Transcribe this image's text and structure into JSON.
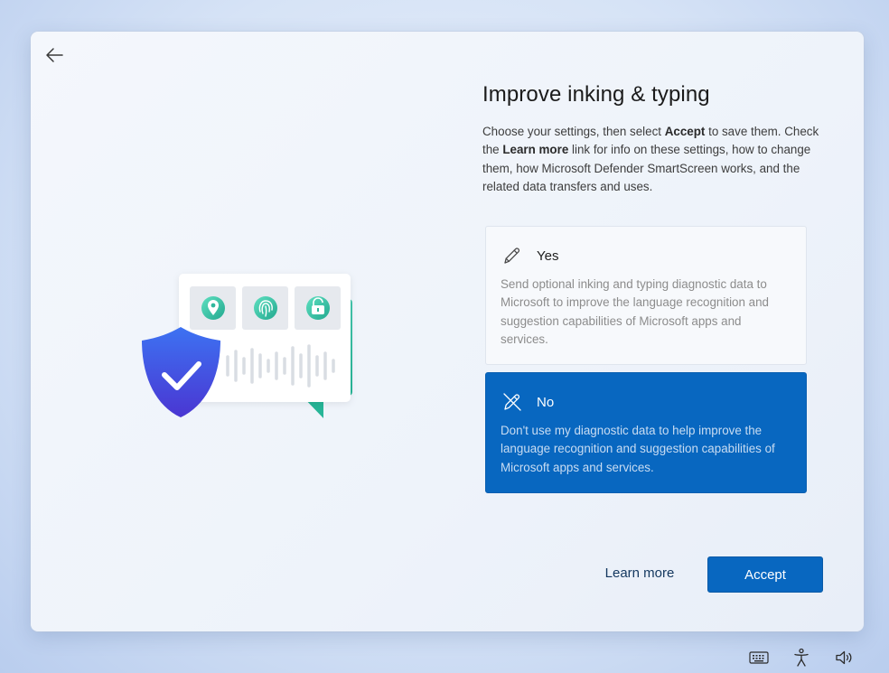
{
  "header": {
    "back_icon": "arrow-left-icon"
  },
  "page": {
    "title": "Improve inking & typing",
    "description": {
      "part1": "Choose your settings, then select ",
      "accept_bold": "Accept",
      "part2": " to save them. Check the ",
      "learn_more_bold": "Learn more",
      "part3": " link for info on these settings, how to change them, how Microsoft Defender SmartScreen works, and the related data transfers and uses."
    }
  },
  "options": [
    {
      "id": "yes",
      "label": "Yes",
      "icon": "pen-icon",
      "description": "Send optional inking and typing diagnostic data to Microsoft to improve the language recognition and suggestion capabilities of Microsoft apps and services.",
      "selected": false
    },
    {
      "id": "no",
      "label": "No",
      "icon": "pen-off-icon",
      "description": "Don't use my diagnostic data to help improve the language recognition and suggestion capabilities of Microsoft apps and services.",
      "selected": true
    }
  ],
  "footer": {
    "learn_more_label": "Learn more",
    "accept_label": "Accept"
  },
  "tray": {
    "icons": [
      "keyboard-icon",
      "accessibility-icon",
      "volume-icon"
    ]
  },
  "colors": {
    "accent": "#0867c0",
    "shield_top": "#3d6ff0",
    "shield_bottom": "#4b3dd6",
    "chat_bubble": "#3ec9ad"
  }
}
